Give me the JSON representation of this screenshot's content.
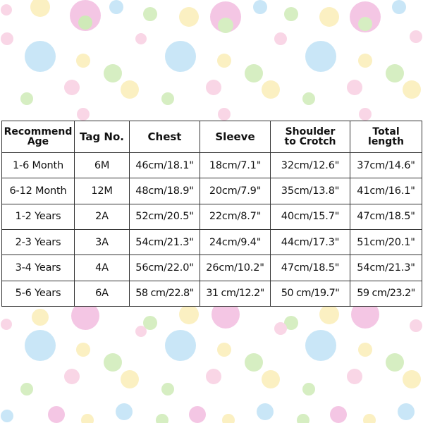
{
  "size_chart": {
    "headers": [
      {
        "line1": "Recommend",
        "line2": "Age"
      },
      {
        "line1": "Tag No.",
        "line2": ""
      },
      {
        "line1": "Chest",
        "line2": ""
      },
      {
        "line1": "Sleeve",
        "line2": ""
      },
      {
        "line1": "Shoulder",
        "line2": "to Crotch"
      },
      {
        "line1": "Total",
        "line2": "length"
      }
    ],
    "rows": [
      [
        "1-6 Month",
        "6M",
        "46cm/18.1\"",
        "18cm/7.1\"",
        "32cm/12.6\"",
        "37cm/14.6\""
      ],
      [
        "6-12 Month",
        "12M",
        "48cm/18.9\"",
        "20cm/7.9\"",
        "35cm/13.8\"",
        "41cm/16.1\""
      ],
      [
        "1-2 Years",
        "2A",
        "52cm/20.5\"",
        "22cm/8.7\"",
        "40cm/15.7\"",
        "47cm/18.5\""
      ],
      [
        "2-3 Years",
        "3A",
        "54cm/21.3\"",
        "24cm/9.4\"",
        "44cm/17.3\"",
        "51cm/20.1\""
      ],
      [
        "3-4 Years",
        "4A",
        "56cm/22.0\"",
        "26cm/10.2\"",
        "47cm/18.5\"",
        "54cm/21.3\""
      ],
      [
        "5-6 Years",
        "6A",
        "58 cm/22.8\"",
        "31 cm/12.2\"",
        "50 cm/19.7\"",
        "59 cm/23.2\""
      ]
    ]
  },
  "background": {
    "pattern": "pastel-polka-dots",
    "colors": [
      "#f4c6e4",
      "#c9e6f7",
      "#d6eec2",
      "#fbf0c2",
      "#f9d6e6",
      "#cfeab8",
      "#f3e7b0"
    ]
  }
}
